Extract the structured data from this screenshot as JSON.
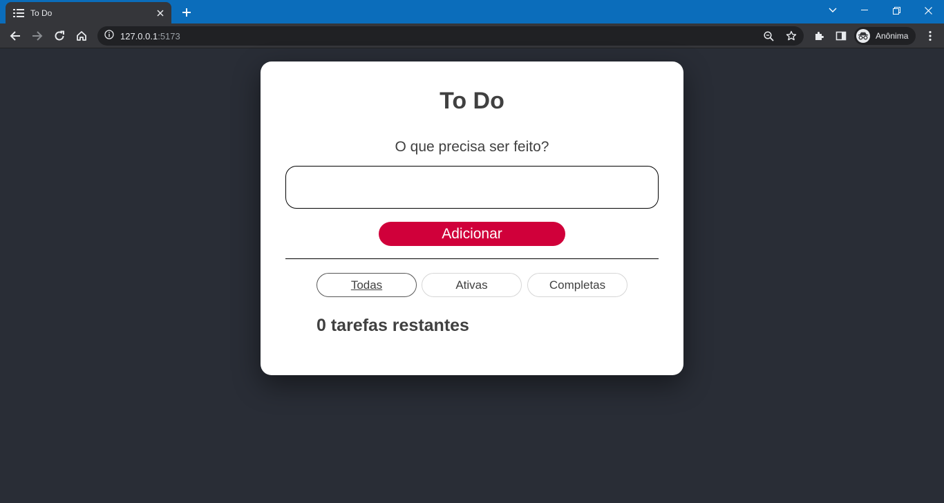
{
  "browser": {
    "tab": {
      "title": "To Do"
    },
    "url": {
      "host": "127.0.0.1",
      "port": ":5173"
    },
    "profile": {
      "label": "Anônima"
    }
  },
  "app": {
    "title": "To Do",
    "prompt": "O que precisa ser feito?",
    "input_value": "",
    "input_placeholder": "",
    "add_button": "Adicionar",
    "filters": [
      {
        "label": "Todas",
        "active": true
      },
      {
        "label": "Ativas",
        "active": false
      },
      {
        "label": "Completas",
        "active": false
      }
    ],
    "remaining_text": "0 tarefas restantes"
  },
  "colors": {
    "tabstrip": "#0b6dbb",
    "page_background": "#292d36",
    "accent_button": "#d0003a",
    "card": "#ffffff",
    "text": "#404040"
  }
}
